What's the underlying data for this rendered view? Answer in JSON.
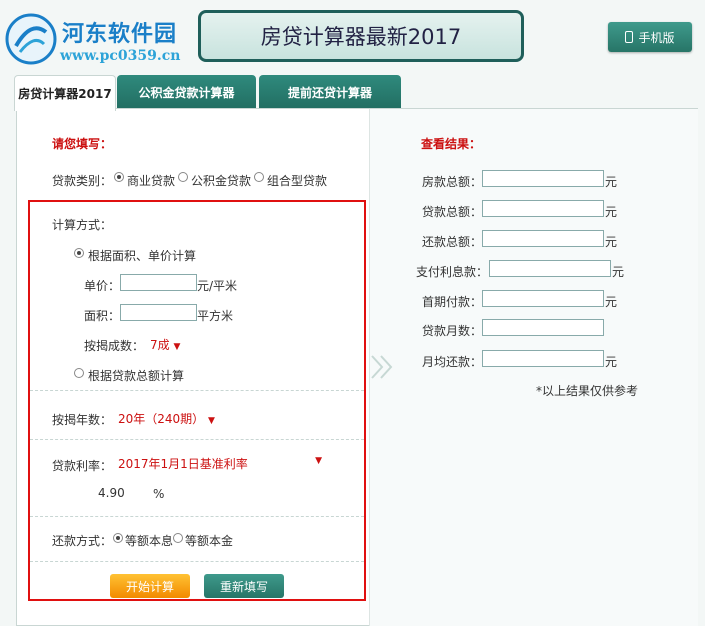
{
  "logo": {
    "name": "河东软件园",
    "url": "www.pc0359.cn"
  },
  "header": {
    "title": "房贷计算器最新2017",
    "mobile_button": "手机版"
  },
  "tabs": [
    {
      "label": "房贷计算器2017"
    },
    {
      "label": "公积金贷款计算器"
    },
    {
      "label": "提前还贷计算器"
    }
  ],
  "form": {
    "heading": "请您填写：",
    "loan_type_label": "贷款类别：",
    "loan_types": [
      "商业贷款",
      "公积金贷款",
      "组合型贷款"
    ],
    "calc_method_label": "计算方式：",
    "method_area": "根据面积、单价计算",
    "unit_price_label": "单价：",
    "unit_price_unit": "元/平米",
    "area_label": "面积：",
    "area_unit": "平方米",
    "ratio_label": "按揭成数：",
    "ratio_value": "7成",
    "method_total": "根据贷款总额计算",
    "years_label": "按揭年数：",
    "years_value": "20年（240期）",
    "rate_label": "贷款利率：",
    "rate_value": "2017年1月1日基准利率",
    "rate_input": "4.90",
    "rate_unit": "%",
    "repay_label": "还款方式：",
    "repay_options": [
      "等额本息",
      "等额本金"
    ],
    "start_button": "开始计算",
    "reset_button": "重新填写"
  },
  "results": {
    "heading": "查看结果：",
    "house_total": "房款总额：",
    "loan_total": "贷款总额：",
    "repay_total": "还款总额：",
    "interest": "支付利息款：",
    "down_payment": "首期付款：",
    "months": "贷款月数：",
    "monthly": "月均还款：",
    "unit": "元",
    "note": "*以上结果仅供参考"
  },
  "colors": {
    "accent": "#277567",
    "required": "#cc1111",
    "highlight_box": "#e01010"
  }
}
